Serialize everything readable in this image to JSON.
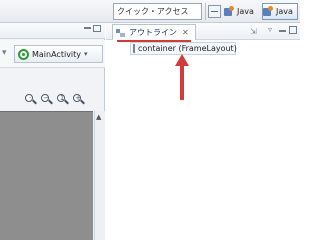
{
  "toolbar": {
    "quick_access": "クイック・アクセス",
    "perspectives": [
      {
        "label": "Java",
        "icon": "java-perspective-icon",
        "active": false
      },
      {
        "label": "Java",
        "icon": "java-perspective-icon",
        "active": true
      }
    ]
  },
  "editor": {
    "config_selector": {
      "label": "MainActivity",
      "icon": "activity-icon"
    },
    "zoom_buttons": [
      "zoom-fit-icon",
      "zoom-out-icon",
      "zoom-actual-icon",
      "zoom-in-icon"
    ]
  },
  "outline": {
    "tab_label": "アウトライン",
    "tree": [
      {
        "label": "container (FrameLayout)",
        "checked": false
      }
    ]
  },
  "colors": {
    "annotation_red": "#d23b3b",
    "canvas_gray": "#8e8e8e"
  }
}
